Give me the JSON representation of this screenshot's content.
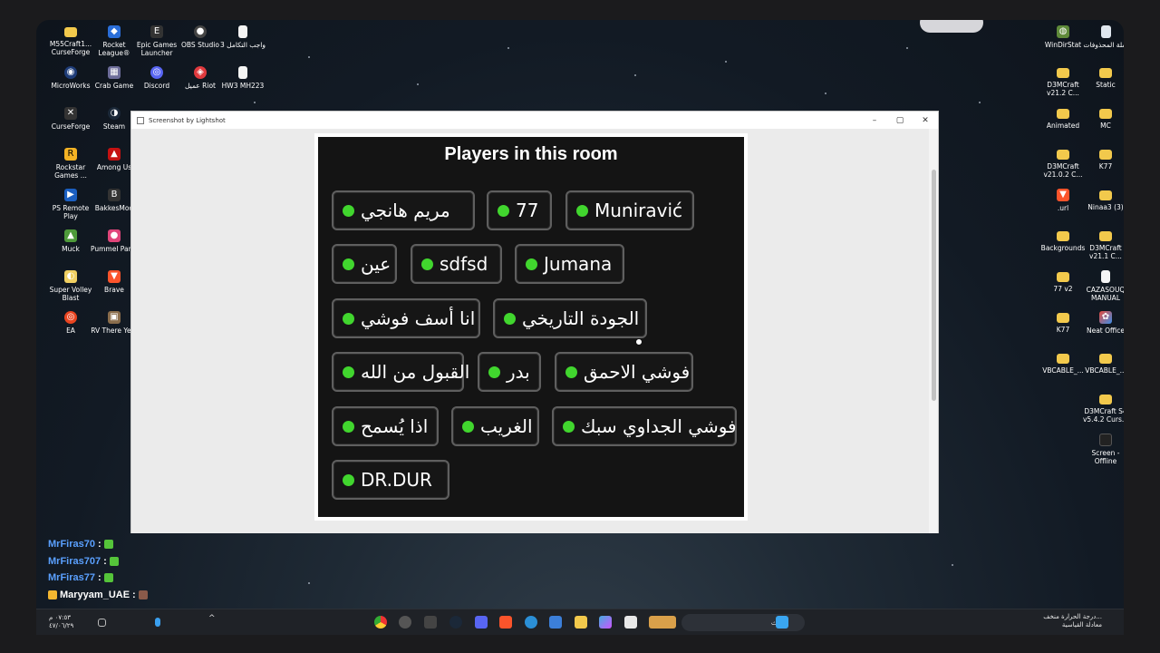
{
  "window": {
    "title": "Screenshot by Lightshot",
    "controls": [
      "–",
      "▢",
      "✕"
    ]
  },
  "panel": {
    "title": "Players in this room",
    "players": [
      "مريم هانجي",
      "77",
      "Muniravić",
      "عين",
      "sdfsd",
      "Jumana",
      "انا أسف فوشي",
      "الجودة التاريخي",
      "القبول من الله",
      "بدر",
      "فوشي الاحمق",
      "اذا يُسمح",
      "الغريب",
      "فوشي الجداوي سبك",
      "DR.DUR"
    ],
    "status_color": "#41d62e"
  },
  "desktop": {
    "icons_left": [
      "M55Craft1... CurseForge",
      "Rocket League®",
      "Epic Games Launcher",
      "OBS Studio",
      "واجب التكامل 3",
      "MicroWorks",
      "Crab Game",
      "Discord",
      "عميل Riot",
      "HW3 MH223",
      "CurseForge",
      "Steam",
      "Rockstar Games ...",
      "Among Us",
      "PS Remote Play",
      "BakkesMod",
      "Muck",
      "Pummel Party",
      "Super Volley Blast",
      "Brave",
      "EA",
      "RV There Ye..."
    ],
    "icons_right": [
      "WinDirStat",
      "سلة المحذوفات",
      "D3MCraft v21.2 C...",
      "Static",
      "Animated",
      "MC",
      "D3MCraft v21.0.2 C...",
      "K77",
      ".url",
      "Ninaa3 (3)",
      "Backgrounds",
      "D3MCraft v21.1 C...",
      "77 v2",
      "CAZASOUQ MANUAL",
      "K77",
      "Neat Office",
      "VBCABLE_...",
      "VBCABLE_...",
      "D3MCraft S4 v5.4.2 Curs...",
      "Screen - Offline"
    ]
  },
  "chat": [
    {
      "user": "MrFiras70",
      "sep": ":"
    },
    {
      "user": "MrFiras707",
      "sep": ":"
    },
    {
      "user": "MrFiras77",
      "sep": ":"
    },
    {
      "user": "Maryyam_UAE",
      "sep": ":"
    }
  ],
  "taskbar": {
    "search_placeholder": "بحث",
    "weather_line1": "درجة الحرارة منخف...",
    "weather_line2": "معادلة القياسية",
    "clock_time": "٠٧:٥٣ م",
    "clock_date": "٤٧/٠٦/٢٩"
  }
}
